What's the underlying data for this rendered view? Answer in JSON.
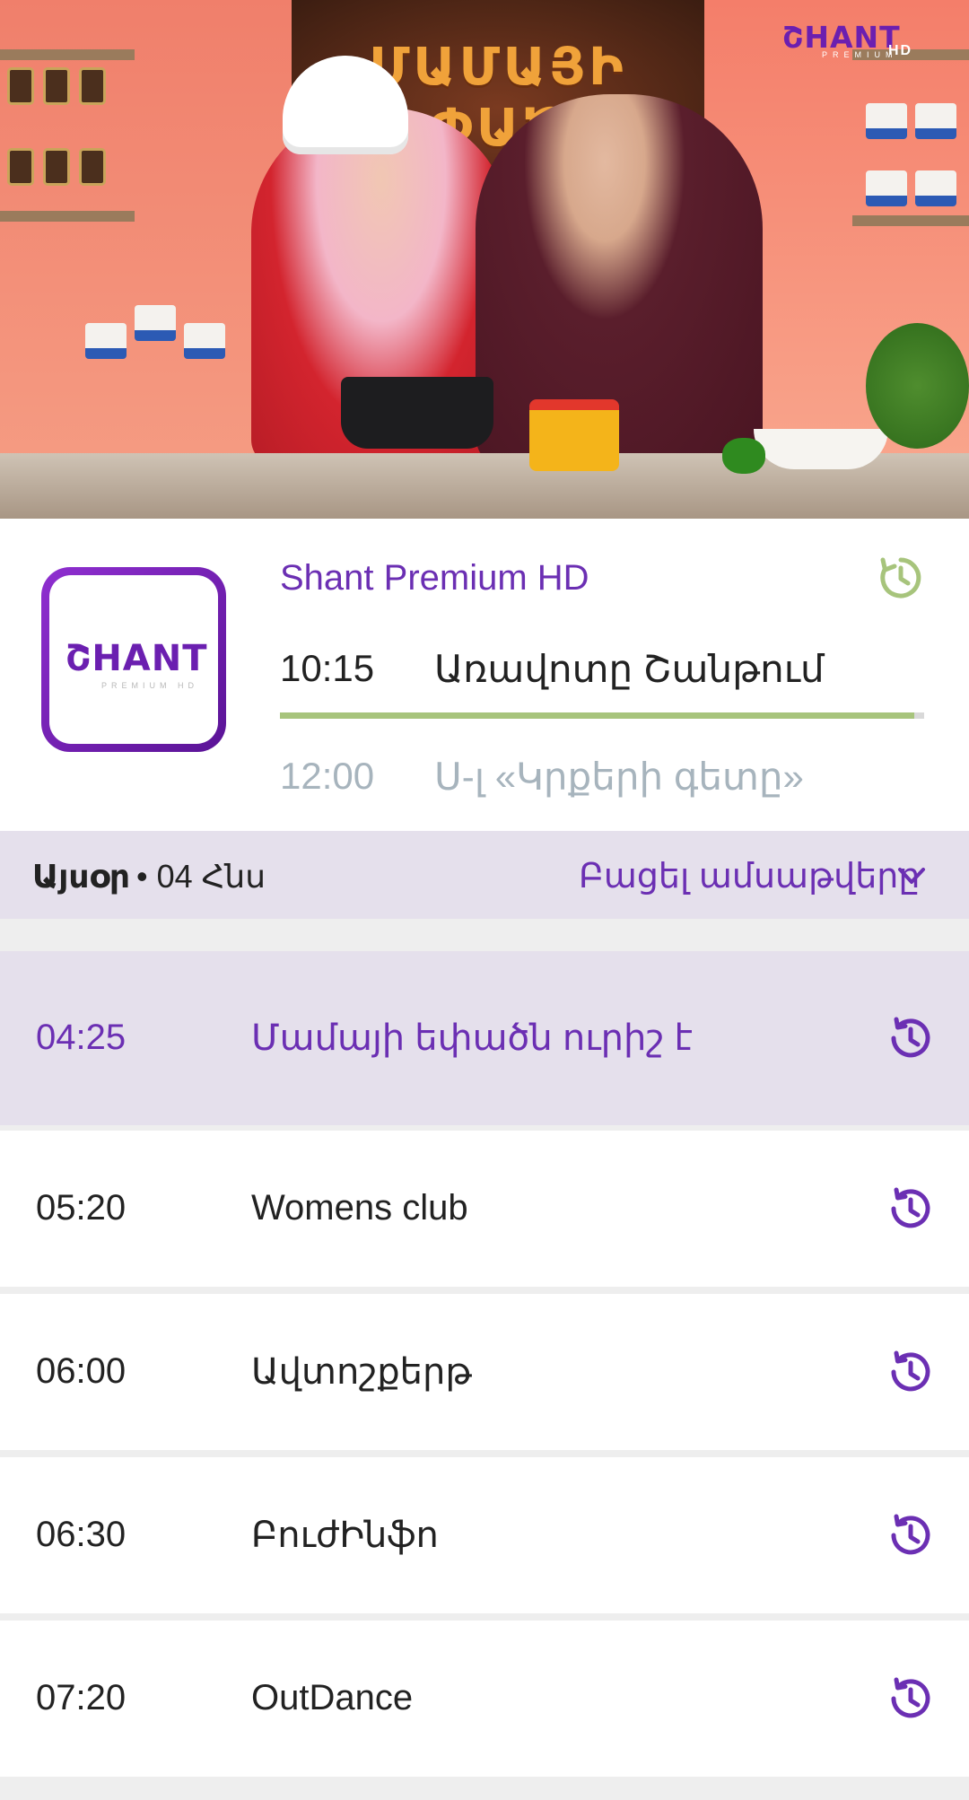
{
  "player": {
    "banner_text": "ՄԱՄԱՅԻ ԵՓԱԾՆ ՈՒՐԻՇ Է",
    "logo": {
      "text": "ՇHANT",
      "sub": "PREMIUM",
      "hd": "HD"
    }
  },
  "channel": {
    "logo": {
      "text": "ՇHANT",
      "sub": "PREMIUM HD"
    },
    "name": "Shant Premium HD",
    "catchup_icon": "catchup-clock-icon",
    "now": {
      "time": "10:15",
      "title": "Առավոտը Շանթում",
      "progress": 0.985
    },
    "next": {
      "time": "12:00",
      "title": "Ս-լ «Կրքերի գետը»"
    }
  },
  "date_bar": {
    "day": "Այսօր",
    "date": "• 04 Հնս",
    "open_archive": "Բացել ամսաթվերը",
    "chevron_icon": "chevron-down-icon"
  },
  "schedule": [
    {
      "time": "04:25",
      "title": "Մամայի եփածն ուրիշ է",
      "icon": "history-icon",
      "current": true
    },
    {
      "time": "05:20",
      "title": "Womens club",
      "icon": "history-icon",
      "current": false
    },
    {
      "time": "06:00",
      "title": "Ավտոշքերթ",
      "icon": "history-icon",
      "current": false
    },
    {
      "time": "06:30",
      "title": "ԲուժԻնֆո",
      "icon": "history-icon",
      "current": false
    },
    {
      "time": "07:20",
      "title": "OutDance",
      "icon": "history-icon",
      "current": false
    }
  ],
  "colors": {
    "accent": "#6b2fb3",
    "progress": "#a7c47c",
    "highlight_bg": "#e5e0ec",
    "muted_text": "#a7b4bd"
  }
}
